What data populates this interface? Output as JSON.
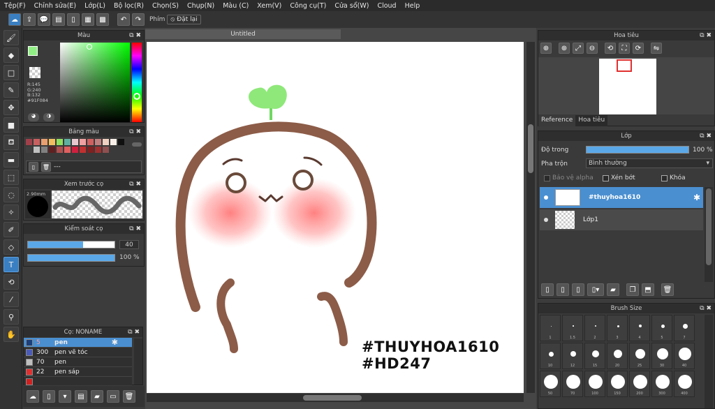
{
  "menu": [
    "Tệp(F)",
    "Chỉnh sửa(E)",
    "Lớp(L)",
    "Bộ lọc(R)",
    "Chọn(S)",
    "Chụp(N)",
    "Màu (C)",
    "Xem(V)",
    "Công cụ(T)",
    "Cửa sổ(W)",
    "Cloud",
    "Help"
  ],
  "toolbar": {
    "phim_label": "Phím",
    "reset_label": "Đặt lại"
  },
  "color_panel": {
    "title": "Màu",
    "r": "R:145",
    "g": "G:240",
    "b": "B:132",
    "hex": "#91F084",
    "fg": "#91f084"
  },
  "palette_panel": {
    "title": "Bảng màu",
    "text": "---",
    "swatches": [
      "#a0404a",
      "#c86060",
      "#e8a070",
      "#f0c060",
      "#90e060",
      "#60b0a0",
      "#e8c8d0",
      "#f0a0a0",
      "#d06060",
      "#c08080",
      "#f0d0c0",
      "#f8f0e8",
      "#101010",
      "#404040",
      "#c0c0c0",
      "#808080",
      "#602020",
      "#b05050",
      "#e06060",
      "#d02040",
      "#c03030",
      "#802020",
      "#a03030",
      "#905050"
    ]
  },
  "brush_preview": {
    "title": "Xem trước cọ",
    "size": "2.90mm"
  },
  "brush_control": {
    "title": "Kiểm soát cọ",
    "size_value": "40",
    "size_fill": 0.64,
    "opacity_value": "100 %",
    "opacity_fill": 1.0
  },
  "brush_list": {
    "title": "Cọ: NONAME",
    "items": [
      {
        "color": "#1a3f7a",
        "size": "5",
        "name": "pen"
      },
      {
        "color": "#4a5ab8",
        "size": "300",
        "name": "pen vẽ tóc"
      },
      {
        "color": "#bfbfbf",
        "size": "70",
        "name": "pen"
      },
      {
        "color": "#e03030",
        "size": "22",
        "name": "pen sáp"
      },
      {
        "color": "#d02020",
        "size": "",
        "name": ""
      }
    ]
  },
  "canvas": {
    "tab_title": "Untitled",
    "watermark_line1": "#THUYHOA1610",
    "watermark_line2": "#HD247"
  },
  "navigator": {
    "title": "Hoa tiêu",
    "tab_reference": "Reference",
    "tab_navigator": "Hoa tiêu"
  },
  "layers": {
    "title": "Lớp",
    "opacity_label": "Độ trong",
    "opacity_value": "100 %",
    "opacity_fill": 1.0,
    "blend_label": "Pha trộn",
    "blend_value": "Bình thường",
    "protect_alpha": "Bảo vệ alpha",
    "clip": "Xén bớt",
    "lock": "Khóa",
    "items": [
      {
        "name": "#thuyhoa1610",
        "selected": true
      },
      {
        "name": "Lớp1",
        "selected": false
      }
    ]
  },
  "brush_size": {
    "title": "Brush Size",
    "labels": [
      "1",
      "1.5",
      "2",
      "3",
      "4",
      "5",
      "7",
      "10",
      "12",
      "15",
      "20",
      "25",
      "30",
      "40",
      "50",
      "70",
      "100",
      "150",
      "200",
      "300",
      "400"
    ]
  }
}
